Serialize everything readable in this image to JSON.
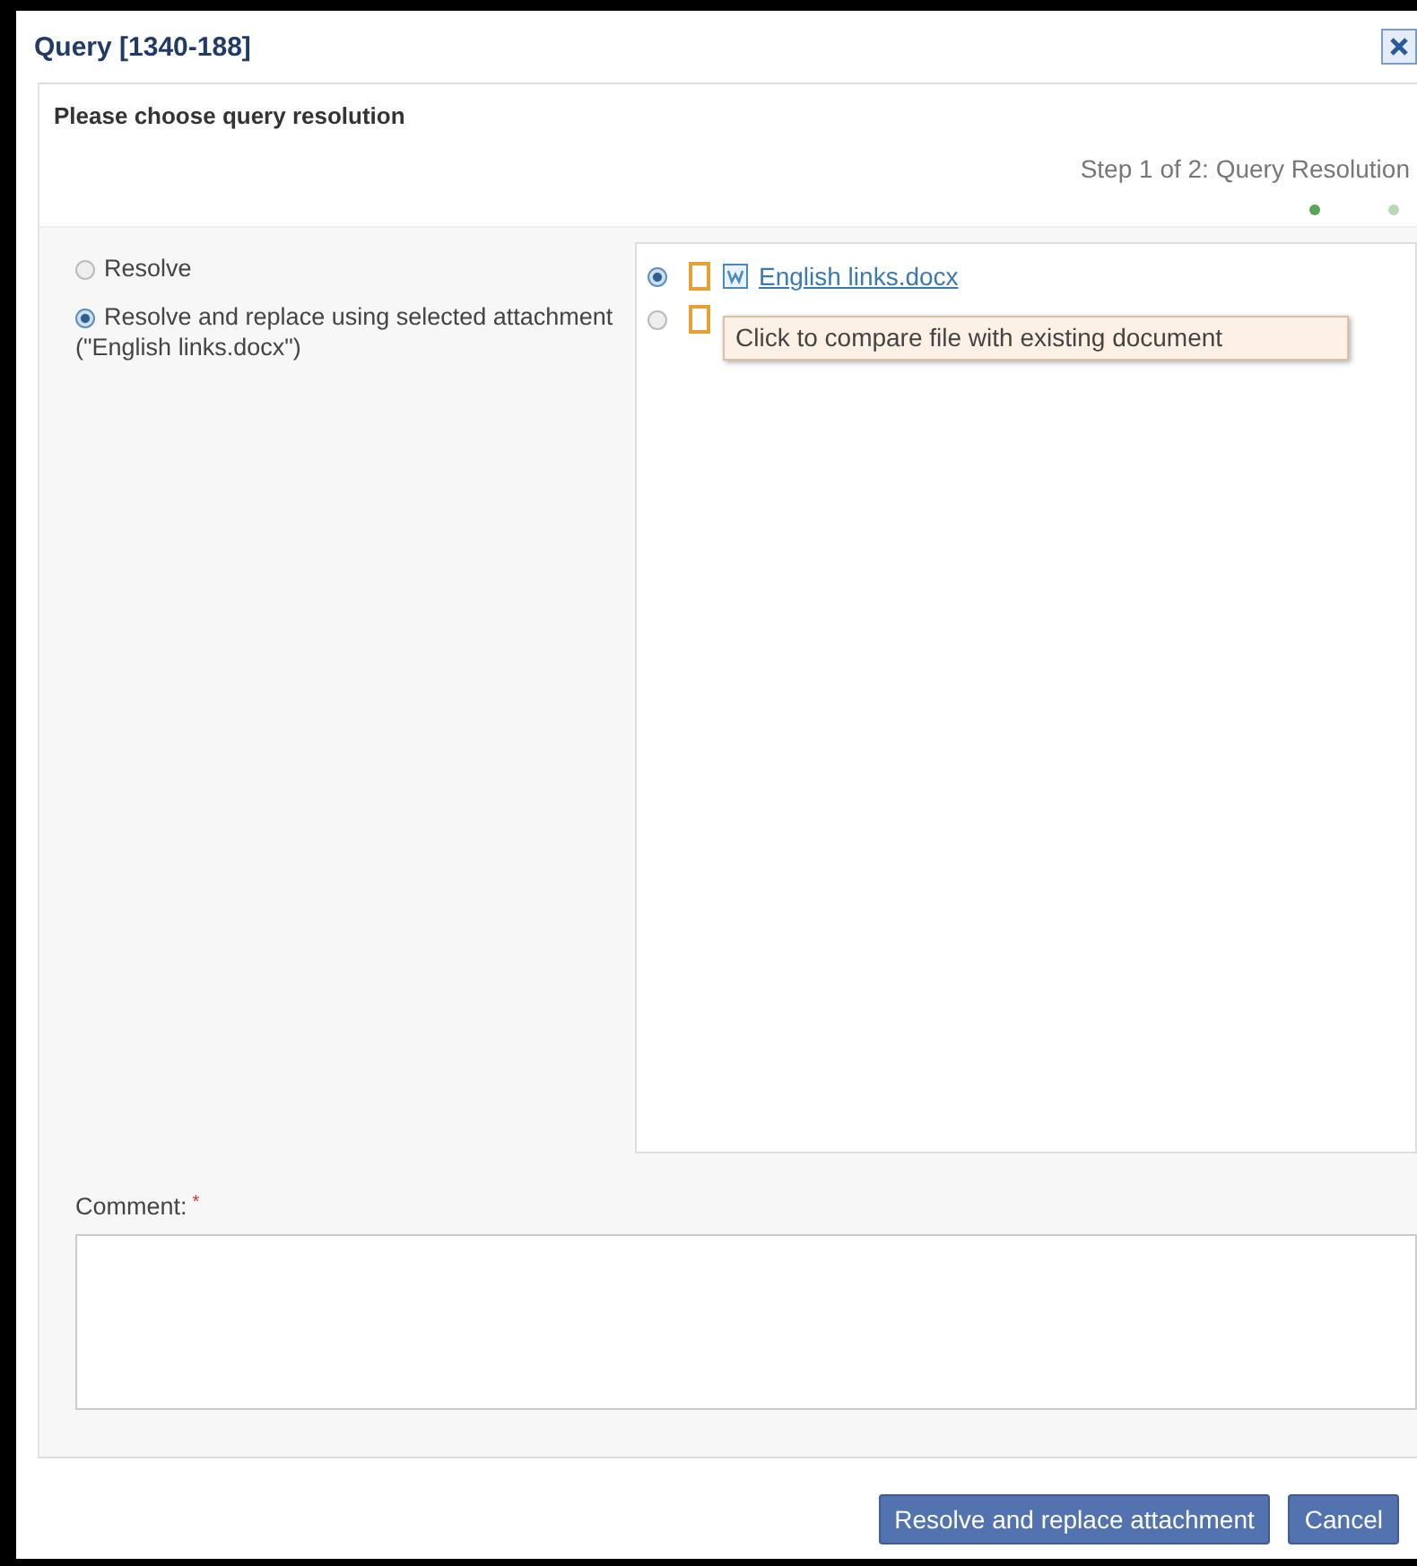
{
  "window": {
    "title": "Query [1340-188]"
  },
  "heading": "Please choose query resolution",
  "step": {
    "label": "Step 1 of 2: Query Resolution",
    "dots": [
      {
        "selected": true
      },
      {
        "selected": false
      }
    ]
  },
  "options": [
    {
      "label": "Resolve",
      "selected": false
    },
    {
      "label": "Resolve and replace using selected attachment (\"English links.docx\")",
      "selected": true
    }
  ],
  "attachments": [
    {
      "name": "English links.docx",
      "selected": true
    },
    {
      "selected": false
    }
  ],
  "tooltip": "Click to compare file with existing document",
  "comment": {
    "label": "Comment:",
    "required_mark": "*"
  },
  "buttons": [
    "Resolve and replace attachment",
    "Cancel"
  ]
}
